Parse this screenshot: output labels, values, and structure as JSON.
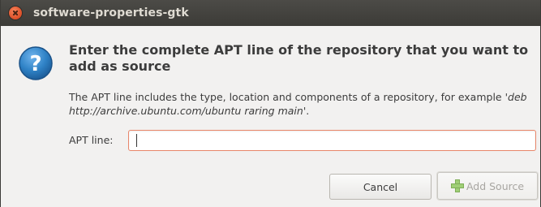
{
  "window": {
    "title": "software-properties-gtk"
  },
  "dialog": {
    "heading": "Enter the complete APT line of the repository that you want to add as source",
    "description_prefix": "The APT line includes the type, location and components of a repository, for example  '",
    "description_example": "deb http://archive.ubuntu.com/ubuntu raring main",
    "description_suffix": "'.",
    "apt_label": "APT line:",
    "apt_value": ""
  },
  "buttons": {
    "cancel": "Cancel",
    "add_source": "Add Source"
  },
  "icons": {
    "close": "close-icon",
    "question": "question-icon",
    "add": "plus-icon"
  },
  "colors": {
    "titlebar": "#3c3b37",
    "close_button": "#e0552e",
    "question_icon": "#2f82c6",
    "input_focus_border": "#e8866a"
  }
}
